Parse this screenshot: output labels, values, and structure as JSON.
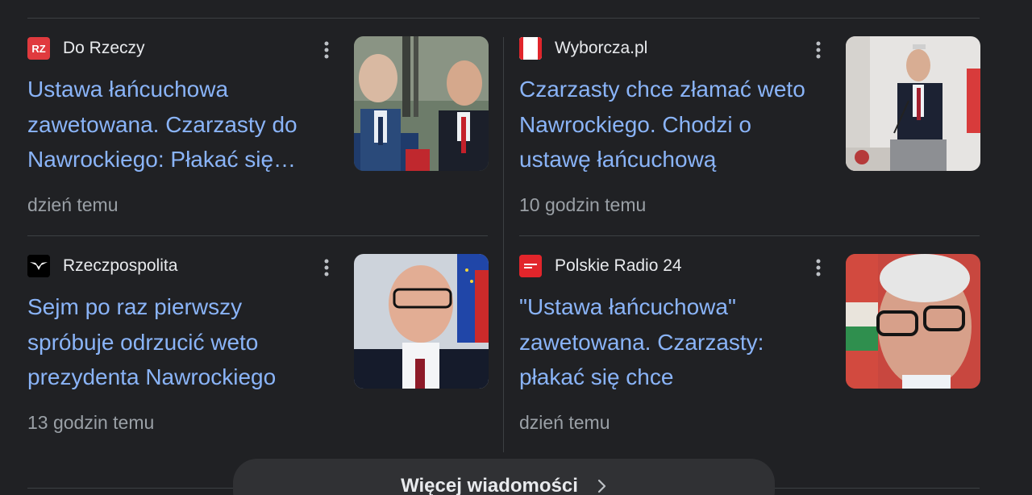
{
  "articles": [
    {
      "source": "Do Rzeczy",
      "favicon_text": "RZ",
      "headline": "Ustawa łańcuchowa zawetowana. Czarzasty do Nawrockiego: Płakać się chce",
      "time": "dzień temu"
    },
    {
      "source": "Wyborcza.pl",
      "favicon_text": "",
      "headline": "Czarzasty chce złamać weto Nawrockiego. Chodzi o ustawę łańcuchową",
      "time": "10 godzin temu"
    },
    {
      "source": "Rzeczpospolita",
      "favicon_text": "",
      "headline": "Sejm po raz pierwszy spróbuje odrzucić weto prezydenta Nawrockiego",
      "time": "13 godzin temu"
    },
    {
      "source": "Polskie Radio 24",
      "favicon_text": "",
      "headline": "\"Ustawa łańcuchowa\" zawetowana. Czarzasty: płakać się chce",
      "time": "dzień temu"
    }
  ],
  "more_news": {
    "label": "Więcej wiadomości"
  },
  "colors": {
    "background": "#202124",
    "headline_link": "#8ab4f8",
    "source_text": "#e8eaed",
    "timestamp_text": "#9aa0a6",
    "divider": "#3c4043",
    "button_bg": "#303134"
  },
  "icons": {
    "more_options": "more-vert-icon",
    "chevron": "chevron-right-icon"
  }
}
